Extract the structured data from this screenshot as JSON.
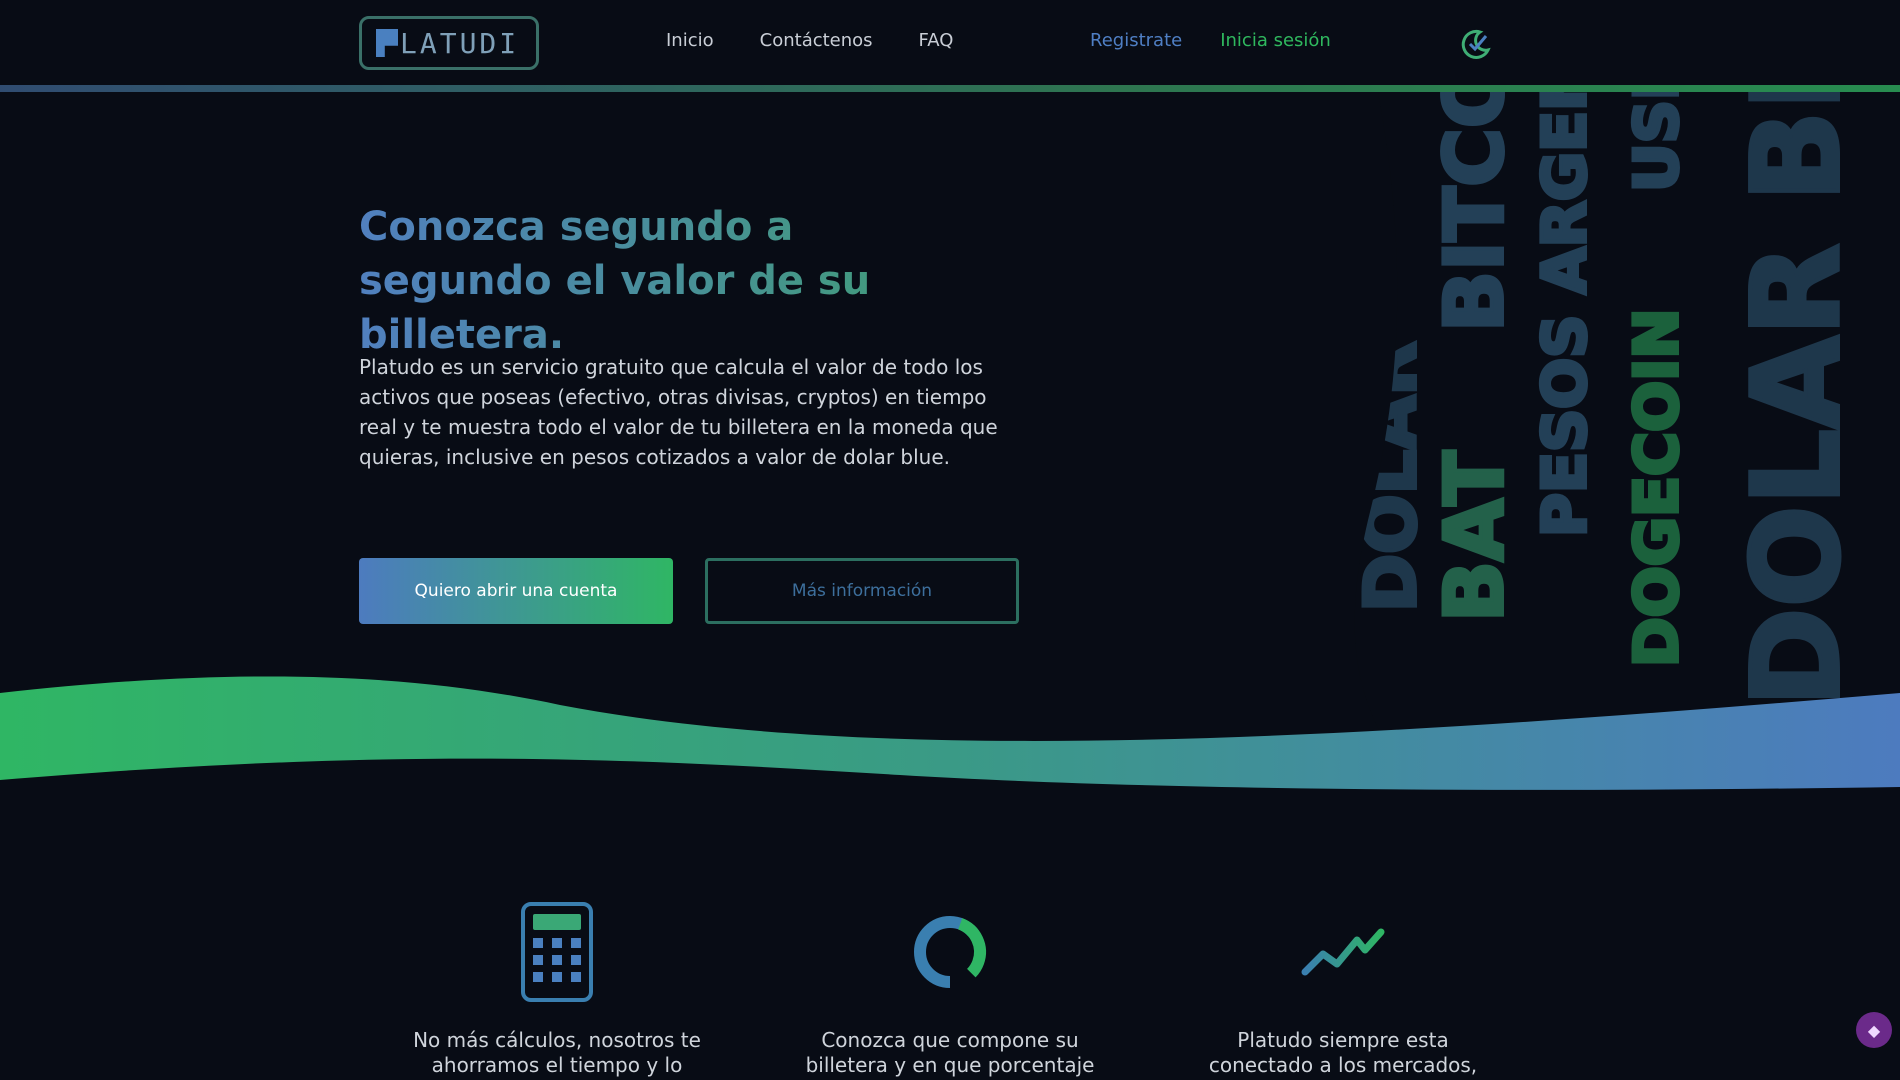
{
  "brand": {
    "logo_text": "LATUDI"
  },
  "nav": {
    "links": [
      "Inicio",
      "Contáctenos",
      "FAQ"
    ],
    "register": "Registrate",
    "login": "Inicia sesión"
  },
  "hero": {
    "title": "Conozca segundo a segundo el valor de su billetera.",
    "description": "Platudo es un servicio gratuito que calcula el valor de todo los activos que poseas (efectivo, otras divisas, cryptos) en tiempo real y te muestra todo el valor de tu billetera en la moneda que quieras, inclusive en pesos cotizados a valor de dolar blue.",
    "primary_button": "Quiero abrir una cuenta",
    "secondary_button": "Más información"
  },
  "decor_words": [
    "DOLAR",
    "BAT",
    "BITCOIN",
    "PESOS ARGENTINOS",
    "DOGECOIN",
    "USDT",
    "DOLAR BLUE"
  ],
  "features": [
    {
      "icon": "calculator-icon",
      "text": "No más cálculos, nosotros te ahorramos el tiempo y lo"
    },
    {
      "icon": "donut-chart-icon",
      "text": "Conozca que compone su billetera y en que porcentaje de"
    },
    {
      "icon": "trend-line-icon",
      "text": "Platudo siempre esta conectado a los mercados, así que te"
    }
  ],
  "colors": {
    "background": "#080c15",
    "blue": "#4d7bbf",
    "green": "#2fb664"
  }
}
